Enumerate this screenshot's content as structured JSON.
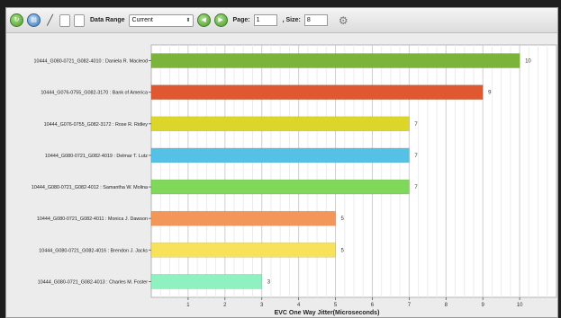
{
  "toolbar": {
    "icons": [
      "green-circle-icon",
      "blue-circle-icon",
      "pen-icon",
      "document-icon",
      "document-stack-icon",
      "green-prev-icon",
      "green-next-icon",
      "gear-icon"
    ],
    "data_range_label": "Data Range",
    "data_range_value": "Current",
    "page_label": "Page:",
    "page_value": "1",
    "size_label": ", Size:",
    "size_value": "8"
  },
  "chart_data": {
    "type": "bar",
    "orientation": "horizontal",
    "xlabel": "EVC One Way Jitter(Microseconds)",
    "xlim": [
      0,
      11
    ],
    "xticks": [
      1,
      2,
      3,
      4,
      5,
      6,
      7,
      8,
      9,
      10
    ],
    "grid": true,
    "categories": [
      "10444_G080-0721_G082-4010 : Daniela R. Macleod",
      "10444_G076-0755_G082-3170 : Bank of America",
      "10444_G076-0755_G082-3172 : Rose R. Ridley",
      "10444_G080-0721_G082-4019 : Delmar T. Lutz",
      "10444_G080-0721_G082-4012 : Samantha W. Molina",
      "10444_G080-0721_G082-4011 : Monica J. Dawson",
      "10444_G080-0721_G082-4016 : Brendon J. Jacks",
      "10444_G080-0721_G082-4013 : Charles M. Foster"
    ],
    "values": [
      10,
      9,
      7,
      7,
      7,
      5,
      5,
      3
    ],
    "data_labels": [
      "10",
      "9",
      "7",
      "7",
      "7",
      "5",
      "5",
      "3"
    ],
    "colors": [
      "#7cb33a",
      "#e0582f",
      "#dcd62a",
      "#56c1e6",
      "#7fd85a",
      "#f2965a",
      "#f7e25a",
      "#8ff0c0"
    ]
  }
}
